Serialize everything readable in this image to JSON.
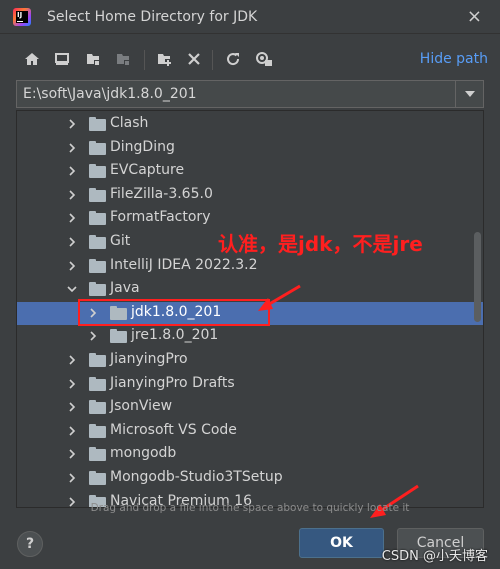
{
  "window": {
    "title": "Select Home Directory for JDK",
    "close_icon": "×"
  },
  "toolbar": {
    "icons": [
      "home-icon",
      "desktop-icon",
      "project-folder-icon",
      "module-folder-icon",
      "new-folder-icon",
      "delete-icon",
      "refresh-icon",
      "show-hidden-icon"
    ],
    "hide_path_label": "Hide path"
  },
  "path_field": {
    "value": "E:\\soft\\Java\\jdk1.8.0_201"
  },
  "tree": {
    "items": [
      {
        "label": "Clash",
        "level": 0,
        "expanded": false,
        "selected": false
      },
      {
        "label": "DingDing",
        "level": 0,
        "expanded": false,
        "selected": false
      },
      {
        "label": "EVCapture",
        "level": 0,
        "expanded": false,
        "selected": false
      },
      {
        "label": "FileZilla-3.65.0",
        "level": 0,
        "expanded": false,
        "selected": false
      },
      {
        "label": "FormatFactory",
        "level": 0,
        "expanded": false,
        "selected": false
      },
      {
        "label": "Git",
        "level": 0,
        "expanded": false,
        "selected": false
      },
      {
        "label": "IntelliJ IDEA 2022.3.2",
        "level": 0,
        "expanded": false,
        "selected": false
      },
      {
        "label": "Java",
        "level": 0,
        "expanded": true,
        "selected": false
      },
      {
        "label": "jdk1.8.0_201",
        "level": 1,
        "expanded": false,
        "selected": true
      },
      {
        "label": "jre1.8.0_201",
        "level": 1,
        "expanded": false,
        "selected": false
      },
      {
        "label": "JianyingPro",
        "level": 0,
        "expanded": false,
        "selected": false
      },
      {
        "label": "JianyingPro Drafts",
        "level": 0,
        "expanded": false,
        "selected": false
      },
      {
        "label": "JsonView",
        "level": 0,
        "expanded": false,
        "selected": false
      },
      {
        "label": "Microsoft VS Code",
        "level": 0,
        "expanded": false,
        "selected": false
      },
      {
        "label": "mongodb",
        "level": 0,
        "expanded": false,
        "selected": false
      },
      {
        "label": "Mongodb-Studio3TSetup",
        "level": 0,
        "expanded": false,
        "selected": false
      },
      {
        "label": "Navicat Premium 16",
        "level": 0,
        "expanded": false,
        "selected": false
      }
    ]
  },
  "annotation": {
    "text": "认准，是jdk，不是jre",
    "color": "#ff1f1f"
  },
  "hint": "Drag and drop a file into the space above to quickly locate it",
  "buttons": {
    "help": "?",
    "ok": "OK",
    "cancel": "Cancel"
  },
  "watermark": "CSDN @小夭博客",
  "colors": {
    "selection": "#4b6eaf",
    "link": "#589df6",
    "ok_button": "#365880"
  }
}
